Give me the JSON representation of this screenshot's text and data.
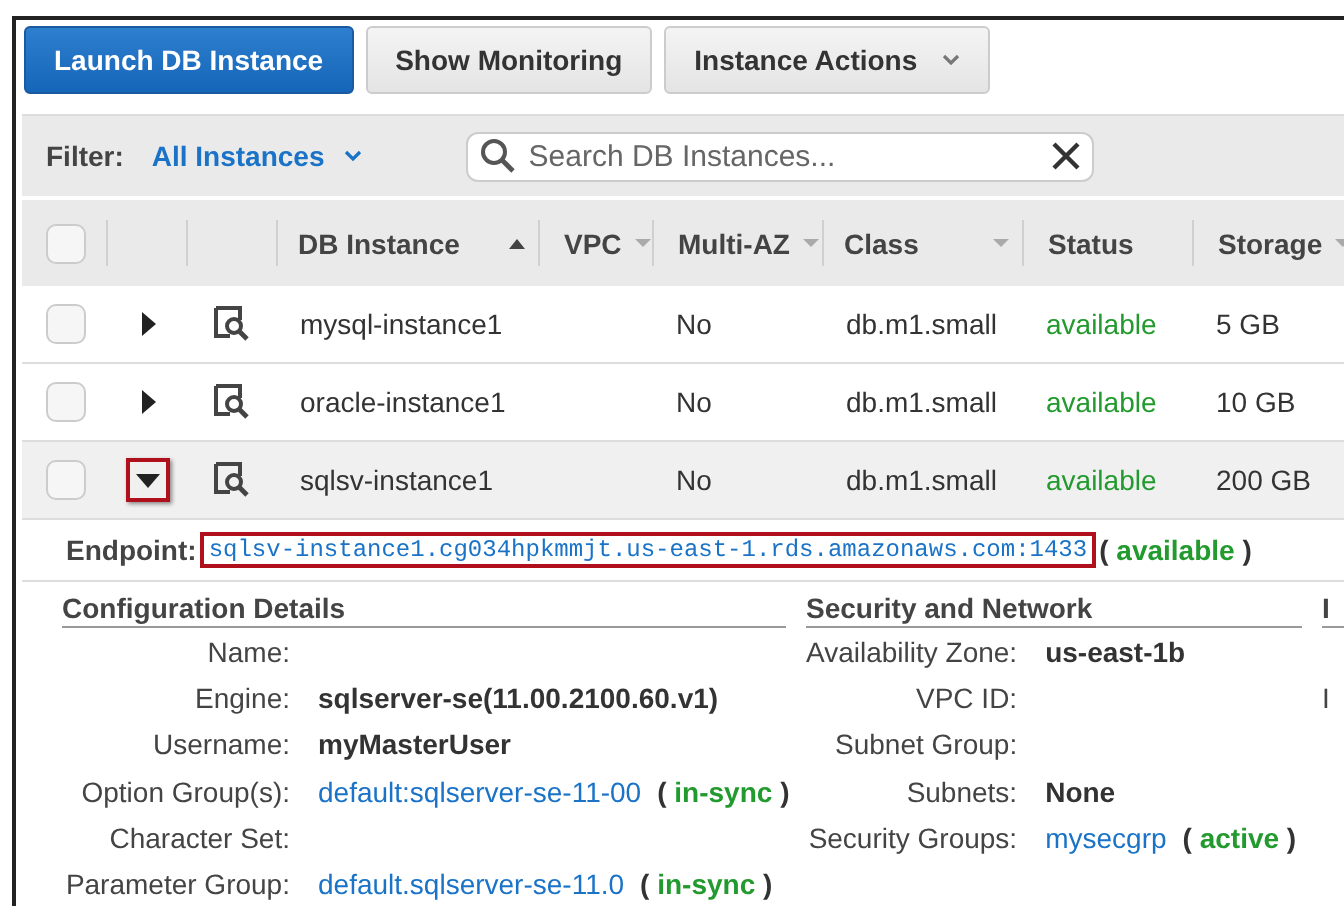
{
  "toolbar": {
    "buttons": [
      {
        "label": "Launch DB Instance",
        "kind": "primary"
      },
      {
        "label": "Show Monitoring",
        "kind": "plain"
      },
      {
        "label": "Instance Actions",
        "kind": "dropdown"
      }
    ]
  },
  "filter": {
    "label": "Filter:",
    "value": "All Instances",
    "search": {
      "placeholder": "Search DB Instances..."
    }
  },
  "table": {
    "select_all_checked": false,
    "columns": [
      {
        "label": "DB Instance",
        "sorted_ascending": true,
        "menu": false
      },
      {
        "label": "VPC",
        "sorted_ascending": false,
        "menu": true
      },
      {
        "label": "Multi-AZ",
        "sorted_ascending": false,
        "menu": true
      },
      {
        "label": "Class",
        "sorted_ascending": false,
        "menu": true
      },
      {
        "label": "Status",
        "sorted_ascending": false,
        "menu": false
      },
      {
        "label": "Storage",
        "sorted_ascending": false,
        "menu": true
      }
    ],
    "rows": [
      {
        "checked": false,
        "expanded": false,
        "highlighted": false,
        "selected": false,
        "cells": [
          "mysql-instance1",
          "",
          "No",
          "db.m1.small",
          "available",
          "5 GB"
        ]
      },
      {
        "checked": false,
        "expanded": false,
        "highlighted": false,
        "selected": false,
        "cells": [
          "oracle-instance1",
          "",
          "No",
          "db.m1.small",
          "available",
          "10 GB"
        ]
      },
      {
        "checked": false,
        "expanded": true,
        "highlighted": true,
        "selected": true,
        "cells": [
          "sqlsv-instance1",
          "",
          "No",
          "db.m1.small",
          "available",
          "200 GB"
        ]
      }
    ]
  },
  "details": {
    "endpoint": {
      "label": "Endpoint:",
      "value": "sqlsv-instance1.cg034hpkmmjt.us-east-1.rds.amazonaws.com:1433",
      "status": "( **available** )",
      "highlighted": true
    },
    "sections": [
      {
        "title": "Configuration Details",
        "fields": [
          {
            "label": "Name:"
          },
          {
            "label": "Engine:",
            "value": "sqlserver-se(11.00.2100.60.v1)",
            "kind": "bold"
          },
          {
            "label": "Username:",
            "value": "myMasterUser",
            "kind": "bold"
          },
          {
            "label": "Option Group(s):",
            "value": "default:sqlserver-se-11-00",
            "kind": "link",
            "status": "( **in-sync** )"
          },
          {
            "label": "Character Set:"
          },
          {
            "label": "Parameter Group:",
            "value": "default.sqlserver-se-11.0",
            "kind": "link",
            "status": "( **in-sync** )"
          }
        ]
      },
      {
        "title": "Security and Network",
        "fields": [
          {
            "label": "Availability Zone:",
            "value": "us-east-1b",
            "kind": "bold"
          },
          {
            "label": "VPC ID:"
          },
          {
            "label": "Subnet Group:"
          },
          {
            "label": "Subnets:",
            "value": "None",
            "kind": "bold"
          },
          {
            "label": "Security Groups:",
            "value": "mysecgrp",
            "kind": "link",
            "status": "( **active** )"
          }
        ]
      },
      {
        "title": "I",
        "fields": [
          {
            "label": "I"
          }
        ]
      }
    ]
  }
}
